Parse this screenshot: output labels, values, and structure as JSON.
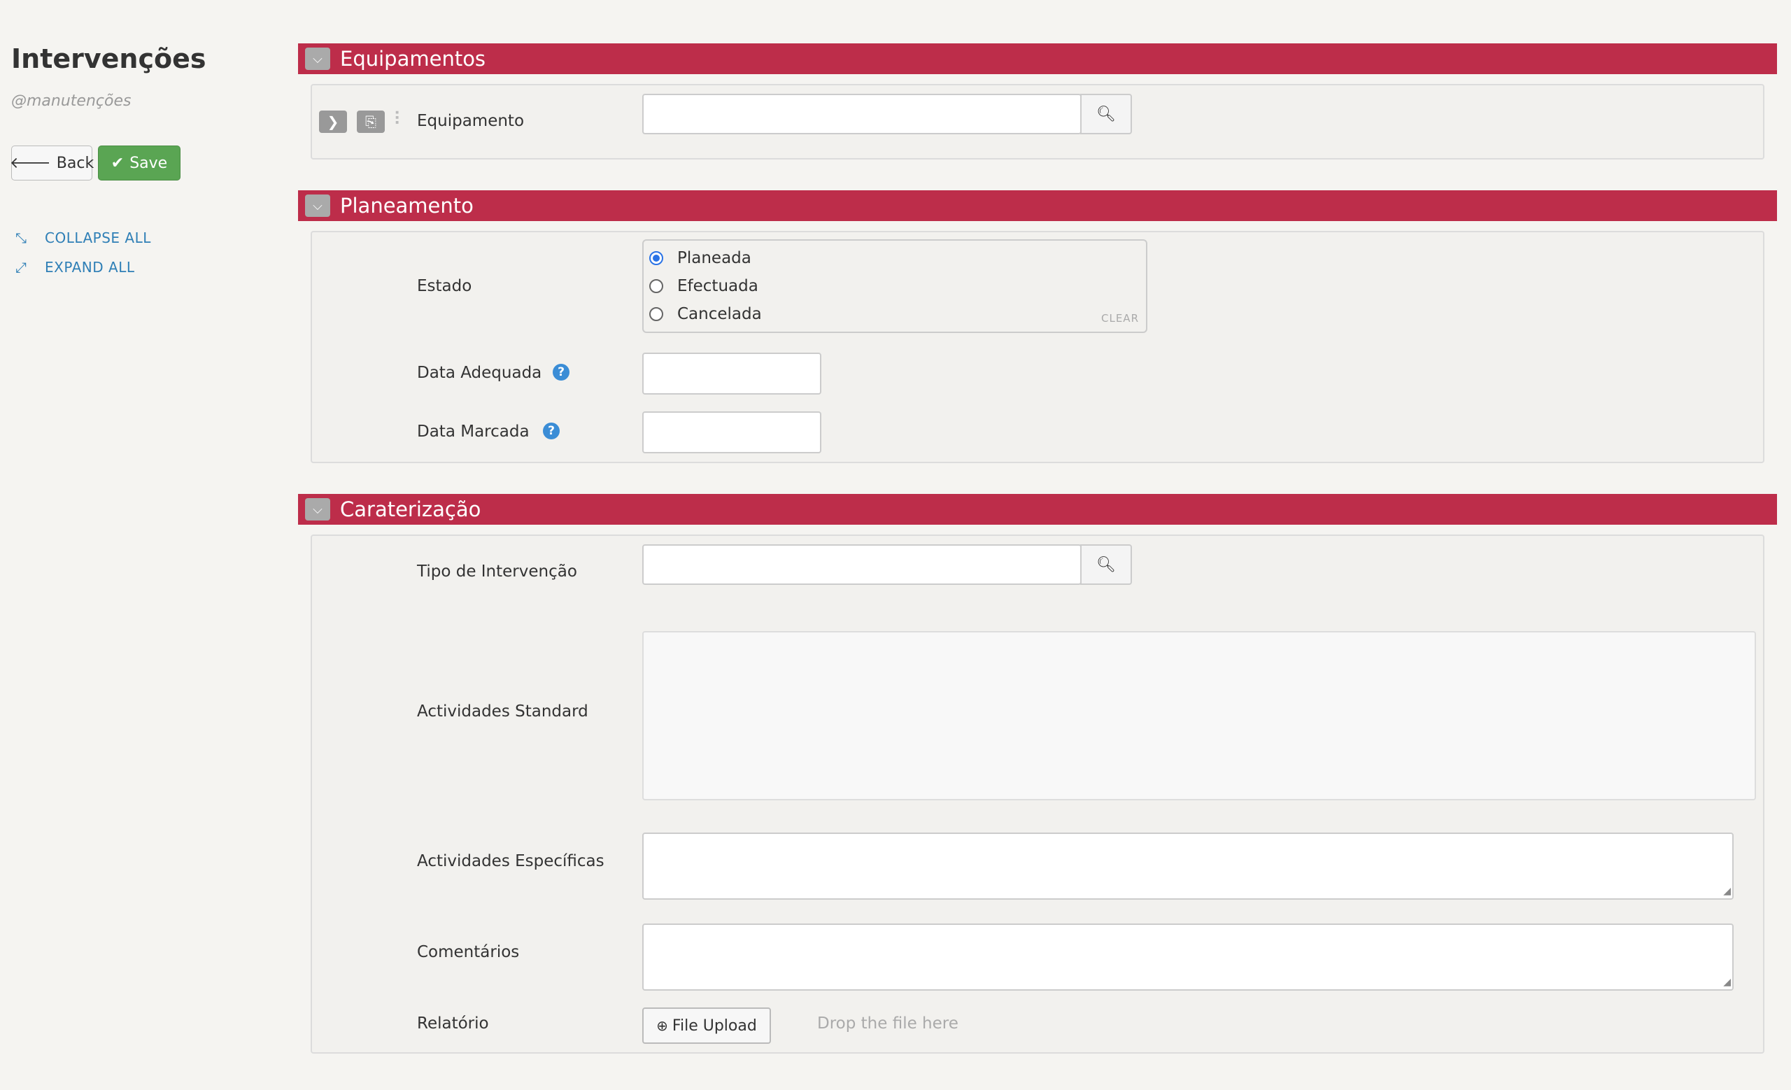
{
  "sidebar": {
    "title": "Intervenções",
    "subtitle": "@manutenções",
    "back_label": "Back",
    "save_label": "Save",
    "collapse_all": "COLLAPSE ALL",
    "expand_all": "EXPAND ALL"
  },
  "sections": {
    "equipamentos": {
      "title": "Equipamentos",
      "equipamento_label": "Equipamento",
      "equipamento_value": ""
    },
    "planeamento": {
      "title": "Planeamento",
      "estado_label": "Estado",
      "estado_options": [
        "Planeada",
        "Efectuada",
        "Cancelada"
      ],
      "estado_selected": "Planeada",
      "clear_label": "CLEAR",
      "data_adequada_label": "Data Adequada",
      "data_adequada_value": "",
      "data_marcada_label": "Data Marcada",
      "data_marcada_value": ""
    },
    "caraterizacao": {
      "title": "Caraterização",
      "tipo_label": "Tipo de Intervenção",
      "tipo_value": "",
      "actividades_standard_label": "Actividades Standard",
      "actividades_especificas_label": "Actividades Específicas",
      "comentarios_label": "Comentários",
      "relatorio_label": "Relatório",
      "file_upload_label": "File Upload",
      "drop_text": "Drop the file here"
    }
  },
  "icons": {
    "help": "?",
    "search": "search-icon"
  },
  "colors": {
    "header_bg": "#bd2d4a",
    "save_bg": "#5aa553",
    "link": "#2f7fb6"
  }
}
